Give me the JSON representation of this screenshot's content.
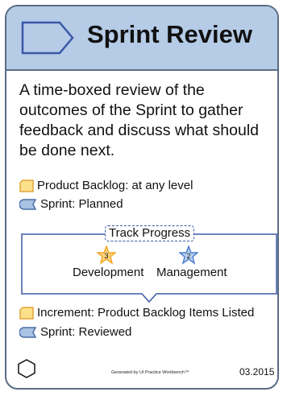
{
  "card": {
    "title": "Sprint Review",
    "description": "A time-boxed review of the outcomes of the Sprint to gather feedback and discuss what should be done next.",
    "inputs": [
      {
        "icon": "artifact-icon",
        "text": "Product Backlog: at any level"
      },
      {
        "icon": "event-icon",
        "text": "Sprint: Planned"
      }
    ],
    "track": {
      "label": "Track Progress",
      "areas": [
        {
          "number": "3",
          "label": "Development",
          "color": "#f5a623"
        },
        {
          "number": "2",
          "label": "Management",
          "color": "#4a7bd0"
        }
      ]
    },
    "outputs": [
      {
        "icon": "artifact-icon",
        "text": "Increment: Product Backlog Items Listed"
      },
      {
        "icon": "event-icon",
        "text": "Sprint: Reviewed"
      }
    ],
    "footer": {
      "generated": "Generated by UI Practice Workbench™",
      "date": "03.2015"
    }
  },
  "colors": {
    "header_bg": "#b5cbe6",
    "border": "#5a6c84",
    "artifact_fill": "#fde08a",
    "artifact_stroke": "#e1a63a",
    "event_fill": "#a8c3e4",
    "event_stroke": "#4a6fa5",
    "track_stroke": "#3a59a6"
  }
}
